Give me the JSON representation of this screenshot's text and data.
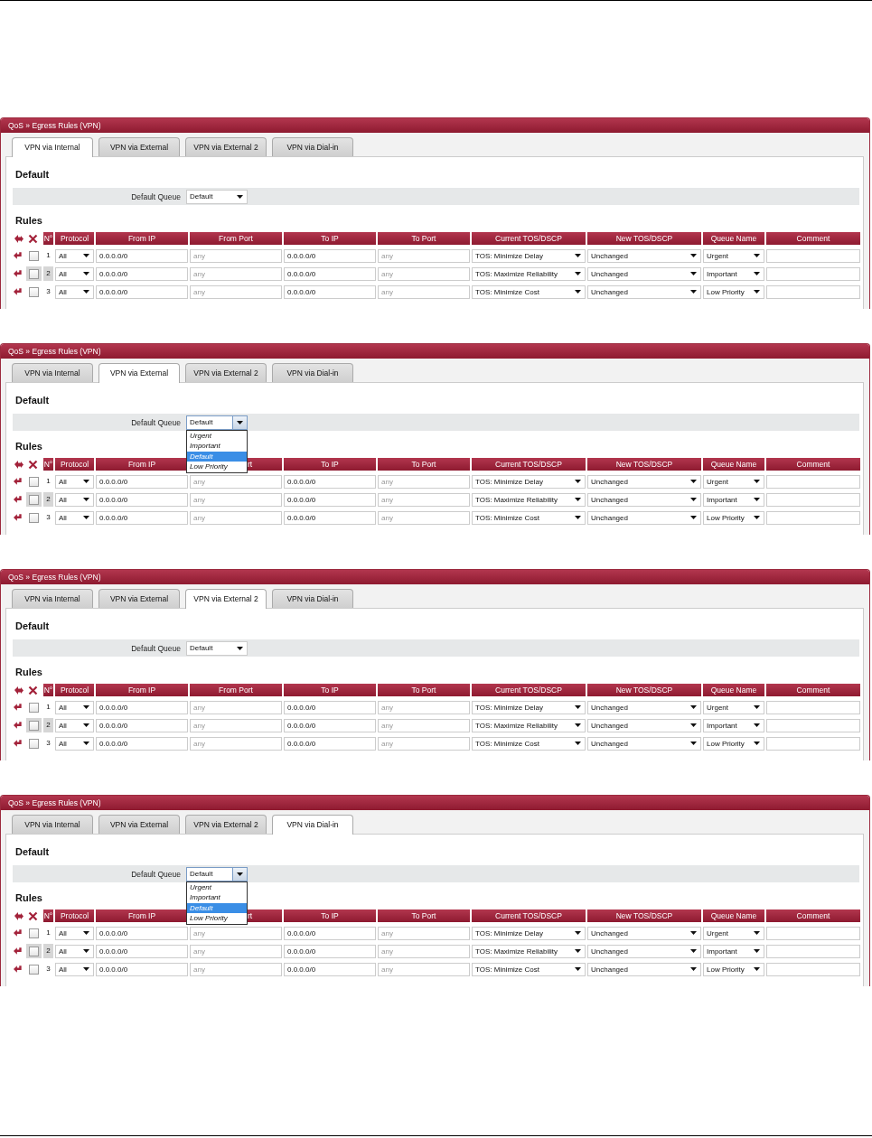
{
  "panels": [
    {
      "title": "QoS » Egress Rules (VPN)",
      "tabs": [
        {
          "label": "VPN via Internal",
          "selected": true
        },
        {
          "label": "VPN via External",
          "selected": false
        },
        {
          "label": "VPN via External 2",
          "selected": false
        },
        {
          "label": "VPN via Dial-in",
          "selected": false
        }
      ],
      "default_heading": "Default",
      "default_queue": {
        "label": "Default Queue",
        "value": "Default",
        "open": false
      },
      "rules_heading": "Rules",
      "columns": [
        {
          "label": "N°",
          "partly_hidden": false
        },
        {
          "label": "Protocol",
          "partly_hidden": false
        },
        {
          "label": "From IP",
          "partly_hidden": false
        },
        {
          "label": "From Port",
          "partly_hidden": false
        },
        {
          "label": "To IP",
          "partly_hidden": false
        },
        {
          "label": "To Port",
          "partly_hidden": false
        },
        {
          "label": "Current TOS/DSCP",
          "partly_hidden": false
        },
        {
          "label": "New TOS/DSCP",
          "partly_hidden": false
        },
        {
          "label": "Queue Name",
          "partly_hidden": false
        },
        {
          "label": "Comment",
          "partly_hidden": false
        }
      ],
      "rows": [
        {
          "number": "1",
          "checked": false,
          "highlighted": false,
          "protocol": "All",
          "from_ip": "0.0.0.0/0",
          "from_port": {
            "placeholder": "any"
          },
          "to_ip": "0.0.0.0/0",
          "to_port": {
            "placeholder": "any"
          },
          "current_tos": "TOS: Minimize Delay",
          "new_tos": "Unchanged",
          "queue": "Urgent"
        },
        {
          "number": "2",
          "checked": false,
          "highlighted": true,
          "protocol": "All",
          "from_ip": "0.0.0.0/0",
          "from_port": {
            "placeholder": "any"
          },
          "to_ip": "0.0.0.0/0",
          "to_port": {
            "placeholder": "any"
          },
          "current_tos": "TOS: Maximize Reliability",
          "new_tos": "Unchanged",
          "queue": "Important"
        },
        {
          "number": "3",
          "checked": false,
          "highlighted": false,
          "protocol": "All",
          "from_ip": "0.0.0.0/0",
          "from_port": {
            "placeholder": "any"
          },
          "to_ip": "0.0.0.0/0",
          "to_port": {
            "placeholder": "any"
          },
          "current_tos": "TOS: Minimize Cost",
          "new_tos": "Unchanged",
          "queue": "Low Priority"
        }
      ]
    },
    {
      "title": "QoS » Egress Rules (VPN)",
      "tabs": [
        {
          "label": "VPN via Internal",
          "selected": false
        },
        {
          "label": "VPN via External",
          "selected": true
        },
        {
          "label": "VPN via External 2",
          "selected": false
        },
        {
          "label": "VPN via Dial-in",
          "selected": false
        }
      ],
      "default_heading": "Default",
      "default_queue": {
        "label": "Default Queue",
        "value": "Default",
        "open": true,
        "options": [
          {
            "label": "Urgent",
            "selected": false
          },
          {
            "label": "Important",
            "selected": false
          },
          {
            "label": "Default",
            "selected": true
          },
          {
            "label": "Low Priority",
            "selected": false
          }
        ]
      },
      "rules_heading": "Rules",
      "columns": [
        {
          "label": "N°",
          "partly_hidden": false
        },
        {
          "label": "Protocol",
          "partly_hidden": false
        },
        {
          "label": "From IP",
          "partly_hidden": false
        },
        {
          "label": "rt",
          "partly_hidden": true
        },
        {
          "label": "To IP",
          "partly_hidden": false
        },
        {
          "label": "To Port",
          "partly_hidden": false
        },
        {
          "label": "Current TOS/DSCP",
          "partly_hidden": false
        },
        {
          "label": "New TOS/DSCP",
          "partly_hidden": false
        },
        {
          "label": "Queue Name",
          "partly_hidden": false
        },
        {
          "label": "Comment",
          "partly_hidden": false
        }
      ],
      "rows": [
        {
          "number": "1",
          "checked": false,
          "highlighted": false,
          "protocol": "All",
          "from_ip": "0.0.0.0/0",
          "from_port": {
            "placeholder": "any"
          },
          "to_ip": "0.0.0.0/0",
          "to_port": {
            "placeholder": "any"
          },
          "current_tos": "TOS: Minimize Delay",
          "new_tos": "Unchanged",
          "queue": "Urgent"
        },
        {
          "number": "2",
          "checked": false,
          "highlighted": true,
          "protocol": "All",
          "from_ip": "0.0.0.0/0",
          "from_port": {
            "placeholder": "any"
          },
          "to_ip": "0.0.0.0/0",
          "to_port": {
            "placeholder": "any"
          },
          "current_tos": "TOS: Maximize Reliability",
          "new_tos": "Unchanged",
          "queue": "Important"
        },
        {
          "number": "3",
          "checked": false,
          "highlighted": false,
          "protocol": "All",
          "from_ip": "0.0.0.0/0",
          "from_port": {
            "placeholder": "any"
          },
          "to_ip": "0.0.0.0/0",
          "to_port": {
            "placeholder": "any"
          },
          "current_tos": "TOS: Minimize Cost",
          "new_tos": "Unchanged",
          "queue": "Low Priority"
        }
      ]
    },
    {
      "title": "QoS » Egress Rules (VPN)",
      "tabs": [
        {
          "label": "VPN via Internal",
          "selected": false
        },
        {
          "label": "VPN via External",
          "selected": false
        },
        {
          "label": "VPN via External 2",
          "selected": true
        },
        {
          "label": "VPN via Dial-in",
          "selected": false
        }
      ],
      "default_heading": "Default",
      "default_queue": {
        "label": "Default Queue",
        "value": "Default",
        "open": false
      },
      "rules_heading": "Rules",
      "columns": [
        {
          "label": "N°",
          "partly_hidden": false
        },
        {
          "label": "Protocol",
          "partly_hidden": false
        },
        {
          "label": "From IP",
          "partly_hidden": false
        },
        {
          "label": "From Port",
          "partly_hidden": false
        },
        {
          "label": "To IP",
          "partly_hidden": false
        },
        {
          "label": "To Port",
          "partly_hidden": false
        },
        {
          "label": "Current TOS/DSCP",
          "partly_hidden": false
        },
        {
          "label": "New TOS/DSCP",
          "partly_hidden": false
        },
        {
          "label": "Queue Name",
          "partly_hidden": false
        },
        {
          "label": "Comment",
          "partly_hidden": false
        }
      ],
      "rows": [
        {
          "number": "1",
          "checked": false,
          "highlighted": false,
          "protocol": "All",
          "from_ip": "0.0.0.0/0",
          "from_port": {
            "placeholder": "any"
          },
          "to_ip": "0.0.0.0/0",
          "to_port": {
            "placeholder": "any"
          },
          "current_tos": "TOS: Minimize Delay",
          "new_tos": "Unchanged",
          "queue": "Urgent"
        },
        {
          "number": "2",
          "checked": false,
          "highlighted": true,
          "protocol": "All",
          "from_ip": "0.0.0.0/0",
          "from_port": {
            "placeholder": "any"
          },
          "to_ip": "0.0.0.0/0",
          "to_port": {
            "placeholder": "any"
          },
          "current_tos": "TOS: Maximize Reliability",
          "new_tos": "Unchanged",
          "queue": "Important"
        },
        {
          "number": "3",
          "checked": false,
          "highlighted": false,
          "protocol": "All",
          "from_ip": "0.0.0.0/0",
          "from_port": {
            "placeholder": "any"
          },
          "to_ip": "0.0.0.0/0",
          "to_port": {
            "placeholder": "any"
          },
          "current_tos": "TOS: Minimize Cost",
          "new_tos": "Unchanged",
          "queue": "Low Priority"
        }
      ]
    },
    {
      "title": "QoS » Egress Rules (VPN)",
      "tabs": [
        {
          "label": "VPN via Internal",
          "selected": false
        },
        {
          "label": "VPN via External",
          "selected": false
        },
        {
          "label": "VPN via External 2",
          "selected": false
        },
        {
          "label": "VPN via Dial-in",
          "selected": true
        }
      ],
      "default_heading": "Default",
      "default_queue": {
        "label": "Default Queue",
        "value": "Default",
        "open": true,
        "options": [
          {
            "label": "Urgent",
            "selected": false
          },
          {
            "label": "Important",
            "selected": false
          },
          {
            "label": "Default",
            "selected": true
          },
          {
            "label": "Low Priority",
            "selected": false
          }
        ]
      },
      "rules_heading": "Rules",
      "columns": [
        {
          "label": "N°",
          "partly_hidden": false
        },
        {
          "label": "Protocol",
          "partly_hidden": false
        },
        {
          "label": "From IP",
          "partly_hidden": false
        },
        {
          "label": "rt",
          "partly_hidden": true
        },
        {
          "label": "To IP",
          "partly_hidden": false
        },
        {
          "label": "To Port",
          "partly_hidden": false
        },
        {
          "label": "Current TOS/DSCP",
          "partly_hidden": false
        },
        {
          "label": "New TOS/DSCP",
          "partly_hidden": false
        },
        {
          "label": "Queue Name",
          "partly_hidden": false
        },
        {
          "label": "Comment",
          "partly_hidden": false
        }
      ],
      "rows": [
        {
          "number": "1",
          "checked": false,
          "highlighted": false,
          "protocol": "All",
          "from_ip": "0.0.0.0/0",
          "from_port": {
            "placeholder": "any"
          },
          "to_ip": "0.0.0.0/0",
          "to_port": {
            "placeholder": "any"
          },
          "current_tos": "TOS: Minimize Delay",
          "new_tos": "Unchanged",
          "queue": "Urgent"
        },
        {
          "number": "2",
          "checked": false,
          "highlighted": true,
          "protocol": "All",
          "from_ip": "0.0.0.0/0",
          "from_port": {
            "placeholder": "any"
          },
          "to_ip": "0.0.0.0/0",
          "to_port": {
            "placeholder": "any"
          },
          "current_tos": "TOS: Maximize Reliability",
          "new_tos": "Unchanged",
          "queue": "Important"
        },
        {
          "number": "3",
          "checked": false,
          "highlighted": false,
          "protocol": "All",
          "from_ip": "0.0.0.0/0",
          "from_port": {
            "placeholder": "any"
          },
          "to_ip": "0.0.0.0/0",
          "to_port": {
            "placeholder": "any"
          },
          "current_tos": "TOS: Minimize Cost",
          "new_tos": "Unchanged",
          "queue": "Low Priority"
        }
      ]
    }
  ]
}
